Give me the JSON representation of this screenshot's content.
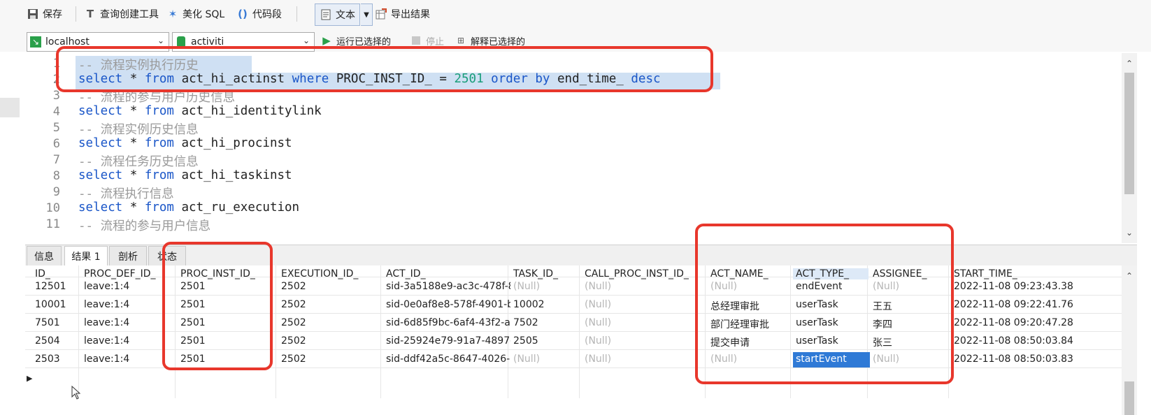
{
  "toolbar": {
    "save": "保存",
    "query_builder": "查询创建工具",
    "beautify_sql": "美化 SQL",
    "code_snippet": "代码段",
    "text": "文本",
    "export": "导出结果"
  },
  "connection": {
    "host": "localhost",
    "database": "activiti",
    "run_selected": "运行已选择的",
    "stop": "停止",
    "explain_selected": "解释已选择的"
  },
  "editor": {
    "lines": [
      {
        "num": "1",
        "text": "-- 流程实例执行历史"
      },
      {
        "num": "2",
        "text": "select * from act_hi_actinst where PROC_INST_ID_ = 2501 order by end_time_ desc"
      },
      {
        "num": "3",
        "text": "-- 流程的参与用户历史信息"
      },
      {
        "num": "4",
        "text": "select * from act_hi_identitylink"
      },
      {
        "num": "5",
        "text": "-- 流程实例历史信息"
      },
      {
        "num": "6",
        "text": "select * from act_hi_procinst"
      },
      {
        "num": "7",
        "text": "-- 流程任务历史信息"
      },
      {
        "num": "8",
        "text": "select * from act_hi_taskinst"
      },
      {
        "num": "9",
        "text": "-- 流程执行信息"
      },
      {
        "num": "10",
        "text": "select * from act_ru_execution"
      },
      {
        "num": "11",
        "text": "-- 流程的参与用户信息"
      }
    ]
  },
  "tabs": [
    "信息",
    "结果 1",
    "剖析",
    "状态"
  ],
  "grid": {
    "columns": [
      "ID_",
      "PROC_DEF_ID_",
      "PROC_INST_ID_",
      "EXECUTION_ID_",
      "ACT_ID_",
      "TASK_ID_",
      "CALL_PROC_INST_ID_",
      "ACT_NAME_",
      "ACT_TYPE_",
      "ASSIGNEE_",
      "START_TIME_"
    ],
    "rows": [
      [
        "12501",
        "leave:1:4",
        "2501",
        "2502",
        "sid-3a5188e9-ac3c-478f-8",
        "(Null)",
        "(Null)",
        "(Null)",
        "endEvent",
        "(Null)",
        "2022-11-08 09:23:43.38"
      ],
      [
        "10001",
        "leave:1:4",
        "2501",
        "2502",
        "sid-0e0af8e8-578f-4901-b",
        "10002",
        "(Null)",
        "总经理审批",
        "userTask",
        "王五",
        "2022-11-08 09:22:41.76"
      ],
      [
        "7501",
        "leave:1:4",
        "2501",
        "2502",
        "sid-6d85f9bc-6af4-43f2-a",
        "7502",
        "(Null)",
        "部门经理审批",
        "userTask",
        "李四",
        "2022-11-08 09:20:47.28"
      ],
      [
        "2504",
        "leave:1:4",
        "2501",
        "2502",
        "sid-25924e79-91a7-4897-",
        "2505",
        "(Null)",
        "提交申请",
        "userTask",
        "张三",
        "2022-11-08 08:50:03.84"
      ],
      [
        "2503",
        "leave:1:4",
        "2501",
        "2502",
        "sid-ddf42a5c-8647-4026-",
        "(Null)",
        "(Null)",
        "(Null)",
        "startEvent",
        "(Null)",
        "2022-11-08 08:50:03.83"
      ]
    ]
  },
  "colors": {
    "annotation": "#e8372c",
    "selection": "#cfe0f3",
    "keyword": "#1a56c8",
    "number": "#1a9e7a",
    "selected_cell": "#2f7ad6"
  }
}
